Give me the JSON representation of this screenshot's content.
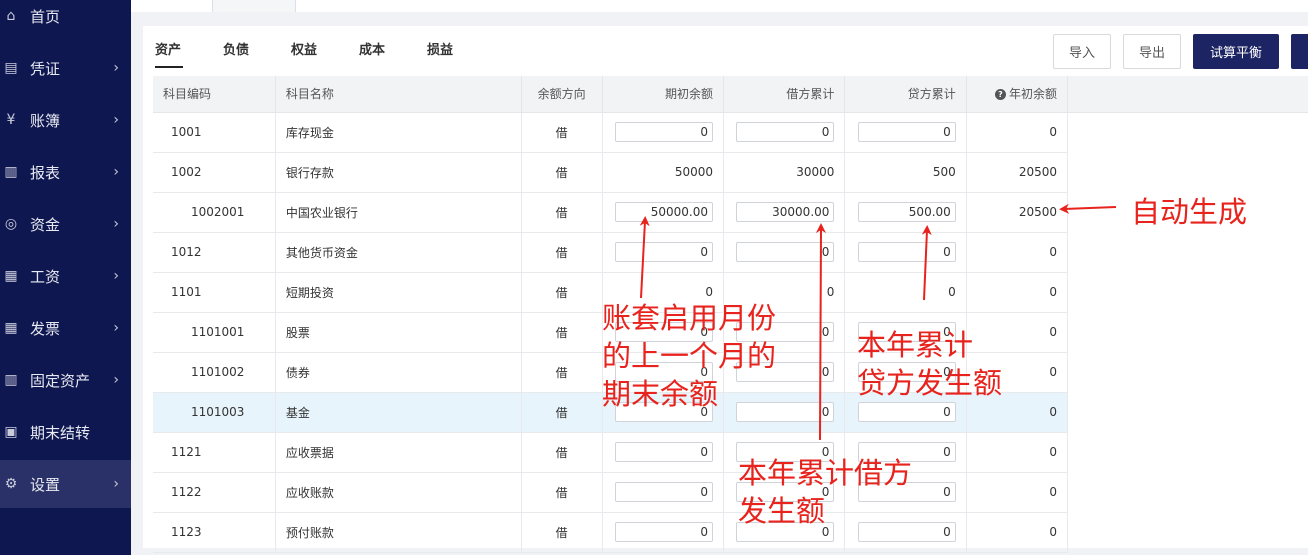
{
  "sidebar": {
    "items": [
      {
        "label": "首页",
        "icon": "home-icon",
        "glyph": "⌂",
        "chevron": false
      },
      {
        "label": "凭证",
        "icon": "voucher-icon",
        "glyph": "▤",
        "chevron": true
      },
      {
        "label": "账簿",
        "icon": "yen-icon",
        "glyph": "¥",
        "chevron": true
      },
      {
        "label": "报表",
        "icon": "chart-icon",
        "glyph": "▥",
        "chevron": true
      },
      {
        "label": "资金",
        "icon": "money-bag-icon",
        "glyph": "◎",
        "chevron": true
      },
      {
        "label": "工资",
        "icon": "document-icon",
        "glyph": "▦",
        "chevron": true
      },
      {
        "label": "发票",
        "icon": "invoice-icon",
        "glyph": "▦",
        "chevron": true
      },
      {
        "label": "固定资产",
        "icon": "building-icon",
        "glyph": "▥",
        "chevron": true
      },
      {
        "label": "期末结转",
        "icon": "transfer-icon",
        "glyph": "▣",
        "chevron": false
      },
      {
        "label": "设置",
        "icon": "gear-icon",
        "glyph": "⚙",
        "chevron": true,
        "active": true
      }
    ],
    "chevron_glyph": "›"
  },
  "tabs": [
    "资产",
    "负债",
    "权益",
    "成本",
    "损益"
  ],
  "toolbar": {
    "import_label": "导入",
    "export_label": "导出",
    "trial_balance_label": "试算平衡"
  },
  "table": {
    "headers": {
      "code": "科目编码",
      "name": "科目名称",
      "direction": "余额方向",
      "opening": "期初余额",
      "debit": "借方累计",
      "credit": "贷方累计",
      "year_begin": "年初余额"
    },
    "help_icon": "?",
    "rows": [
      {
        "code": "1001",
        "name": "库存现金",
        "direction": "借",
        "opening": "0",
        "debit": "0",
        "credit": "0",
        "year_begin": "0",
        "level": 1,
        "editable": true
      },
      {
        "code": "1002",
        "name": "银行存款",
        "direction": "借",
        "opening": "50000",
        "debit": "30000",
        "credit": "500",
        "year_begin": "20500",
        "level": 1,
        "editable": false
      },
      {
        "code": "1002001",
        "name": "中国农业银行",
        "direction": "借",
        "opening": "50000.00",
        "debit": "30000.00",
        "credit": "500.00",
        "year_begin": "20500",
        "level": 2,
        "editable": true
      },
      {
        "code": "1012",
        "name": "其他货币资金",
        "direction": "借",
        "opening": "0",
        "debit": "0",
        "credit": "0",
        "year_begin": "0",
        "level": 1,
        "editable": true
      },
      {
        "code": "1101",
        "name": "短期投资",
        "direction": "借",
        "opening": "0",
        "debit": "0",
        "credit": "0",
        "year_begin": "0",
        "level": 1,
        "editable": false
      },
      {
        "code": "1101001",
        "name": "股票",
        "direction": "借",
        "opening": "0",
        "debit": "0",
        "credit": "0",
        "year_begin": "0",
        "level": 2,
        "editable": true
      },
      {
        "code": "1101002",
        "name": "债券",
        "direction": "借",
        "opening": "0",
        "debit": "0",
        "credit": "0",
        "year_begin": "0",
        "level": 2,
        "editable": true
      },
      {
        "code": "1101003",
        "name": "基金",
        "direction": "借",
        "opening": "0",
        "debit": "0",
        "credit": "0",
        "year_begin": "0",
        "level": 2,
        "editable": true,
        "highlight": true
      },
      {
        "code": "1121",
        "name": "应收票据",
        "direction": "借",
        "opening": "0",
        "debit": "0",
        "credit": "0",
        "year_begin": "0",
        "level": 1,
        "editable": true
      },
      {
        "code": "1122",
        "name": "应收账款",
        "direction": "借",
        "opening": "0",
        "debit": "0",
        "credit": "0",
        "year_begin": "0",
        "level": 1,
        "editable": true
      },
      {
        "code": "1123",
        "name": "预付账款",
        "direction": "借",
        "opening": "0",
        "debit": "0",
        "credit": "0",
        "year_begin": "0",
        "level": 1,
        "editable": true
      }
    ]
  },
  "annotations": {
    "auto_generate": "自动生成",
    "opening_note": [
      "账套启用月份",
      "的上一个月的",
      "期末余额"
    ],
    "credit_note": [
      "本年累计",
      "贷方发生额"
    ],
    "debit_note": [
      "本年累计借方",
      "发生额"
    ],
    "color": "#e8221c"
  },
  "colors": {
    "sidebar_bg": "#0f1750",
    "primary_button": "#1c2463",
    "row_highlight": "#e8f4fb"
  }
}
